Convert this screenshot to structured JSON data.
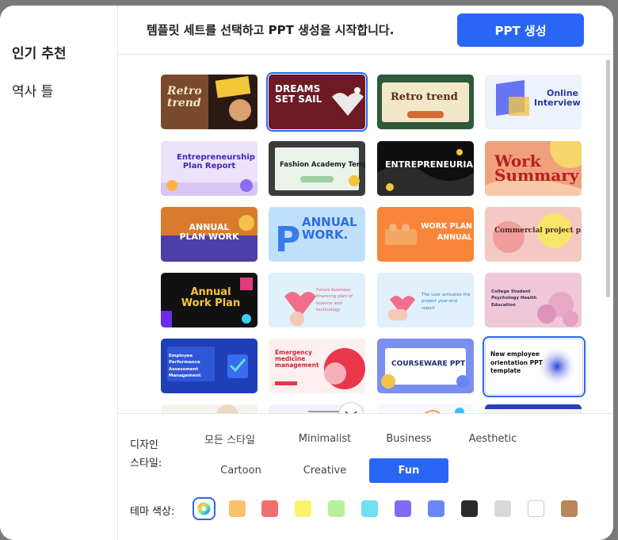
{
  "sidebar": {
    "items": [
      {
        "label": "인기 추천"
      },
      {
        "label": "역사 틀"
      }
    ]
  },
  "header": {
    "instruction": "템플릿 세트를 선택하고 PPT 생성을 시작합니다.",
    "generate_button": "PPT 생성"
  },
  "templates": [
    {
      "label": "Retro trend"
    },
    {
      "label": "DREAMS SET SAIL"
    },
    {
      "label": "Retro trend"
    },
    {
      "label": "Online Interview"
    },
    {
      "label": "Entrepreneurship Plan Report"
    },
    {
      "label": "Fashion Academy Template"
    },
    {
      "label": "ENTREPRENEURIAL"
    },
    {
      "label": "Work Summary"
    },
    {
      "label": "ANNUAL PLAN WORK"
    },
    {
      "label": "ANNUAL WORK."
    },
    {
      "label": "WORK PLAN ANNUAL"
    },
    {
      "label": "Commercial project plan"
    },
    {
      "label": "Annual Work Plan"
    },
    {
      "label": "Future business financing plan of science and technology"
    },
    {
      "label": "The user activates the project year-end report"
    },
    {
      "label": "College Student Psychology Health Education"
    },
    {
      "label": "Employee Performance Assessment Management"
    },
    {
      "label": "Emergency medicine management"
    },
    {
      "label": "COURSEWARE PPT"
    },
    {
      "label": "New employee orientation PPT template"
    }
  ],
  "filters": {
    "style_label": "디자인 스타일:",
    "styles": [
      "모든 스타일",
      "Minimalist",
      "Business",
      "Aesthetic",
      "Cartoon",
      "Creative",
      "Fun"
    ],
    "selected_style": "Fun",
    "color_label": "테마 색상:",
    "colors": [
      "rainbow",
      "#f9c266",
      "#f26d6d",
      "#fdf36a",
      "#b9f09a",
      "#6ee0f0",
      "#7b6cf5",
      "#6a86f5",
      "#2b2b2b",
      "#d9d9d9",
      "#ffffff",
      "#b9855a"
    ]
  }
}
